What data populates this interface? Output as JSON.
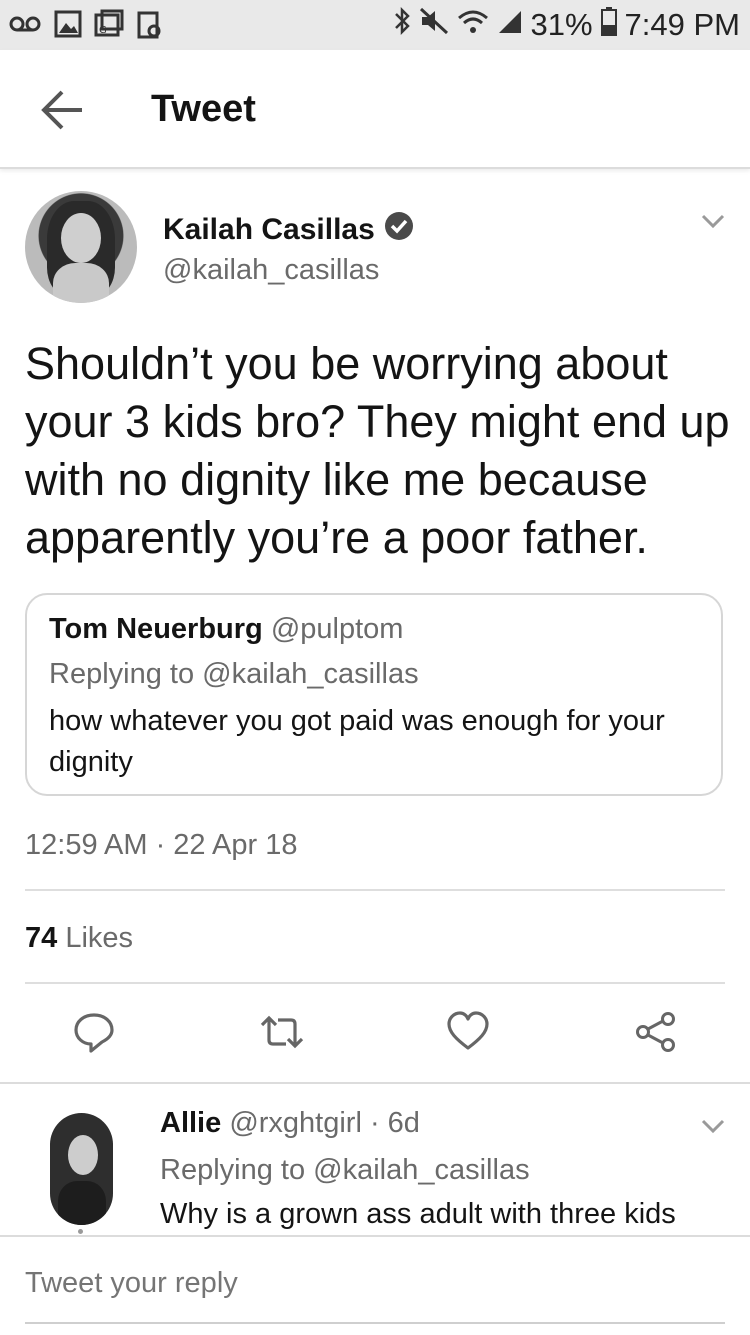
{
  "status_bar": {
    "left_icons": [
      "voicemail-icon",
      "image-icon",
      "gallery-icon",
      "clipboard-icon"
    ],
    "right_icons": [
      "bluetooth-icon",
      "mute-icon",
      "wifi-icon",
      "signal-icon"
    ],
    "battery": "31%",
    "time": "7:49 PM"
  },
  "header": {
    "title": "Tweet"
  },
  "tweet": {
    "author_name": "Kailah Casillas",
    "author_handle": "@kailah_casillas",
    "verified": true,
    "text": "Shouldn’t you be worrying about your 3 kids bro? They might end up with no dignity like me because apparently you’re a poor father.",
    "timestamp": "12:59 AM · 22 Apr 18",
    "likes_count": "74",
    "likes_label": "Likes"
  },
  "quoted_tweet": {
    "name": "Tom Neuerburg",
    "handle": "@pulptom",
    "replying_to": "Replying to @kailah_casillas",
    "text": "how whatever you got paid was enough for your dignity"
  },
  "reply": {
    "name": "Allie",
    "meta": "@rxghtgirl · 6d",
    "replying_to": "Replying to @kailah_casillas",
    "text": "Why is a grown ass adult with three kids"
  },
  "composer": {
    "placeholder": "Tweet your reply"
  },
  "actions": [
    "reply-icon",
    "retweet-icon",
    "like-icon",
    "share-icon"
  ]
}
